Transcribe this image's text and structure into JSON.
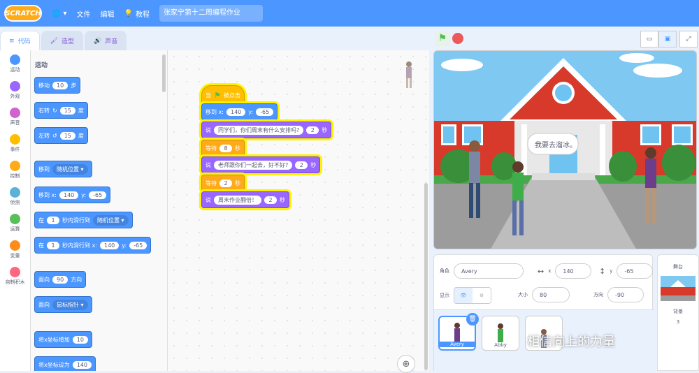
{
  "menubar": {
    "logo": "SCRATCH",
    "file": "文件",
    "edit": "编辑",
    "tutorials": "教程",
    "project_title": "张家宁第十二周编程作业"
  },
  "tabs": {
    "code": "代码",
    "costumes": "造型",
    "sounds": "声音"
  },
  "categories": [
    {
      "label": "运动",
      "color": "#4c97ff"
    },
    {
      "label": "外观",
      "color": "#9966ff"
    },
    {
      "label": "声音",
      "color": "#cf63cf"
    },
    {
      "label": "事件",
      "color": "#ffbf00"
    },
    {
      "label": "控制",
      "color": "#ffab19"
    },
    {
      "label": "侦测",
      "color": "#5cb1d6"
    },
    {
      "label": "运算",
      "color": "#59c059"
    },
    {
      "label": "变量",
      "color": "#ff8c1a"
    },
    {
      "label": "自制积木",
      "color": "#ff6680"
    }
  ],
  "palette": {
    "title": "运动",
    "move": {
      "a": "移动",
      "n": "10",
      "b": "步"
    },
    "turn_right": {
      "a": "右转",
      "n": "15",
      "b": "度"
    },
    "turn_left": {
      "a": "左转",
      "n": "15",
      "b": "度"
    },
    "goto": {
      "a": "移到",
      "d": "随机位置"
    },
    "goto_xy": {
      "a": "移到 x:",
      "x": "140",
      "b": "y:",
      "y": "-65"
    },
    "glide": {
      "a": "在",
      "n": "1",
      "b": "秒内滑行到",
      "d": "随机位置"
    },
    "glide_xy": {
      "a": "在",
      "n": "1",
      "b": "秒内滑行到 x:",
      "x": "140",
      "c": "y:",
      "y": "-65"
    },
    "point_dir": {
      "a": "面向",
      "n": "90",
      "b": "方向"
    },
    "point_towards": {
      "a": "面向",
      "d": "鼠标指针"
    },
    "change_x": {
      "a": "将x坐标增加",
      "n": "10"
    },
    "set_x": {
      "a": "将x坐标设为",
      "n": "140"
    }
  },
  "script": {
    "hat": {
      "a": "当",
      "b": "被点击"
    },
    "goto": {
      "a": "移到 x:",
      "x": "140",
      "b": "y:",
      "y": "-65"
    },
    "say1": {
      "a": "说",
      "text": "同学们，你们周末有什么安排吗?",
      "n": "2",
      "b": "秒"
    },
    "wait1": {
      "a": "等待",
      "n": "8",
      "b": "秒"
    },
    "say2": {
      "a": "说",
      "text": "老师跟你们一起去，好不好?",
      "n": "2",
      "b": "秒"
    },
    "wait2": {
      "a": "等待",
      "n": "2",
      "b": "秒"
    },
    "say3": {
      "a": "说",
      "text": "周末作业翻倍！",
      "n": "2",
      "b": "秒"
    }
  },
  "stage": {
    "speech": "我要去溜冰。"
  },
  "sprite_info": {
    "sprite_label": "角色",
    "sprite_name": "Avery",
    "x_label": "x",
    "x": "140",
    "y_label": "y",
    "y": "-65",
    "show_label": "显示",
    "size_label": "大小",
    "size": "80",
    "direction_label": "方向",
    "direction": "-90"
  },
  "sprites": [
    {
      "name": "Avery"
    },
    {
      "name": "Abby"
    },
    {
      "name": ""
    }
  ],
  "stage_pane": {
    "title": "舞台",
    "backdrop_label": "背景",
    "backdrop_count": "3"
  },
  "watermark": "相信向上的力量"
}
